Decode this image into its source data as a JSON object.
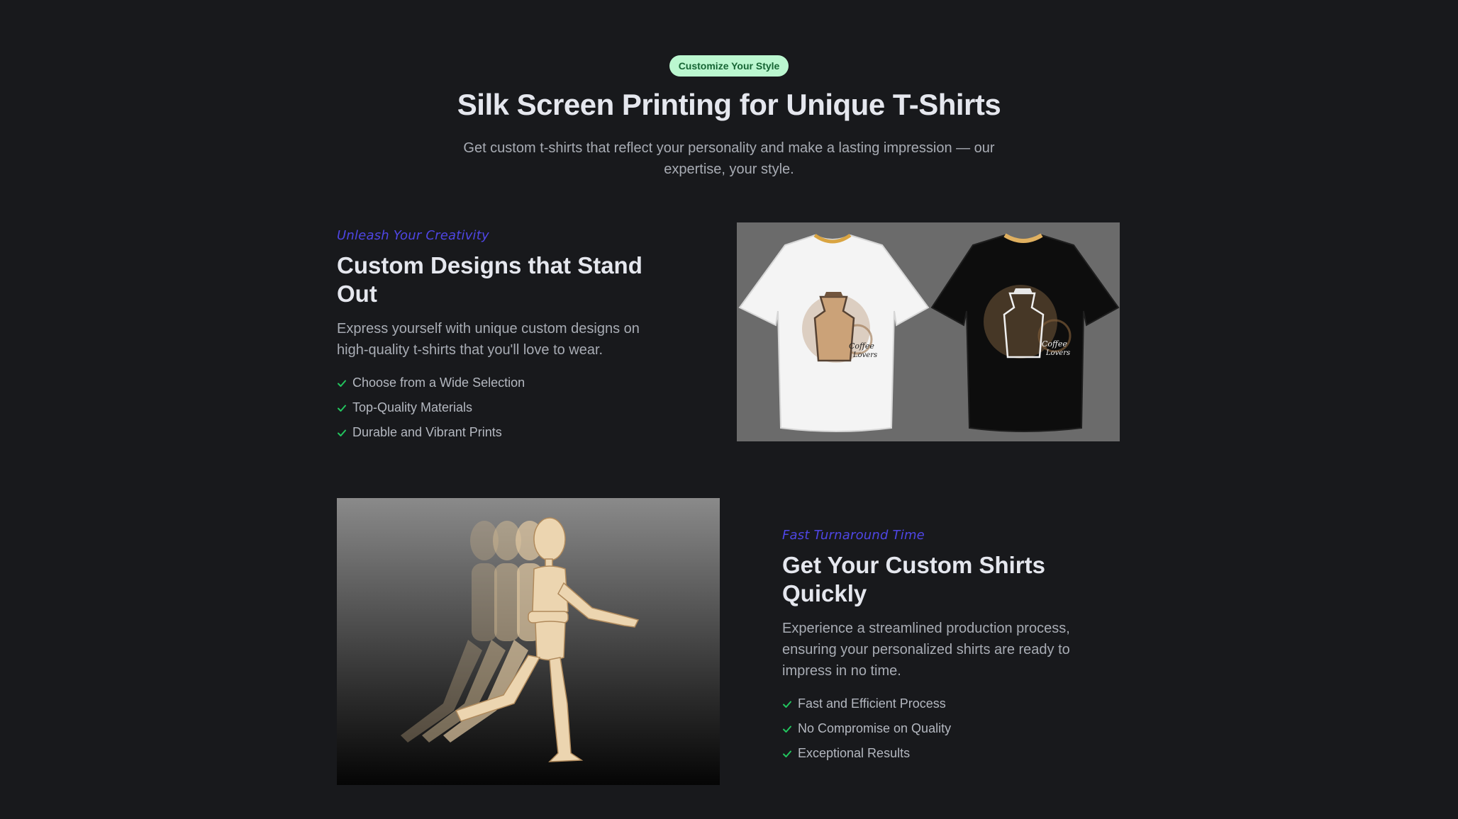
{
  "hero": {
    "badge": "Customize Your Style",
    "title": "Silk Screen Printing for Unique T-Shirts",
    "subtitle": "Get custom t-shirts that reflect your personality and make a lasting impression — our expertise, your style."
  },
  "features": [
    {
      "eyebrow": "Unleash Your Creativity",
      "title": "Custom Designs that Stand Out",
      "description": "Express yourself with unique custom designs on high-quality t-shirts that you'll love to wear.",
      "items": [
        "Choose from a Wide Selection",
        "Top-Quality Materials",
        "Durable and Vibrant Prints"
      ],
      "image_text": [
        "Coffee",
        "Lovers"
      ]
    },
    {
      "eyebrow": "Fast Turnaround Time",
      "title": "Get Your Custom Shirts Quickly",
      "description": "Experience a streamlined production process, ensuring your personalized shirts are ready to impress in no time.",
      "items": [
        "Fast and Efficient Process",
        "No Compromise on Quality",
        "Exceptional Results"
      ]
    }
  ],
  "colors": {
    "background": "#18191c",
    "accent": "#4f46e5",
    "check": "#22c55e",
    "badge_bg": "#bbf7d0",
    "badge_text": "#166534"
  },
  "icons": {
    "check": "check-icon"
  }
}
